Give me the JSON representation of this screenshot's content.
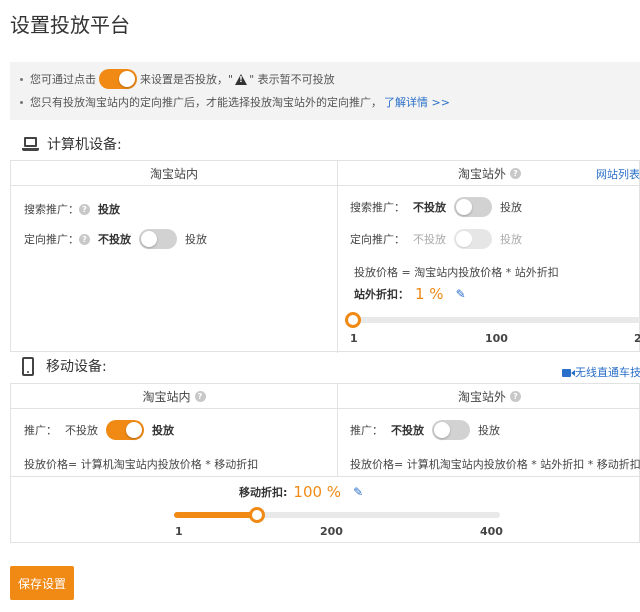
{
  "page": {
    "title": "设置投放平台"
  },
  "notice": {
    "line1_prefix": "您可通过点击",
    "line1_mid": "来设置是否投放，\"",
    "line1_suffix": "\" 表示暂不可投放",
    "line2_text": "您只有投放淘宝站内的定向推广后，才能选择投放淘宝站外的定向推广，",
    "line2_link": "了解详情 >>"
  },
  "pc": {
    "heading": "计算机设备:",
    "col_inside": "淘宝站内",
    "col_outside": "淘宝站外",
    "site_list_link": "网站列表",
    "inside": {
      "search_label": "搜索推广：",
      "search_value": "投放",
      "target_label": "定向推广：",
      "target_off": "不投放",
      "target_on": "投放",
      "target_state": "off"
    },
    "outside": {
      "search_label": "搜索推广：",
      "search_off": "不投放",
      "search_on": "投放",
      "search_state": "off",
      "target_label": "定向推广：",
      "target_off": "不投放",
      "target_on": "投放",
      "target_state": "disabled",
      "price_formula": "投放价格 = 淘宝站内投放价格 * 站外折扣",
      "discount_label": "站外折扣：",
      "discount_value": "1 %",
      "slider": {
        "min_label": "1",
        "mid_label": "100",
        "max_label": "2",
        "value": 1,
        "min": 1,
        "max": 200
      }
    }
  },
  "mobile": {
    "heading": "移动设备:",
    "wireless_link": "无线直通车技",
    "col_inside": "淘宝站内",
    "col_outside": "淘宝站外",
    "inside": {
      "label": "推广：",
      "off": "不投放",
      "on": "投放",
      "state": "on",
      "price_formula": "投放价格= 计算机淘宝站内投放价格 * 移动折扣"
    },
    "outside": {
      "label": "推广：",
      "off": "不投放",
      "on": "投放",
      "state": "off",
      "price_formula": "投放价格= 计算机淘宝站内投放价格 * 站外折扣 * 移动折扣"
    },
    "discount_label": "移动折扣:",
    "discount_value": "100 %",
    "slider": {
      "min_label": "1",
      "mid_label": "200",
      "max_label": "400",
      "value": 100,
      "min": 1,
      "max": 400
    }
  },
  "actions": {
    "save_label": "保存设置"
  },
  "colors": {
    "accent": "#f08a15",
    "link": "#2a6fc9"
  },
  "icons": [
    "warning-icon",
    "laptop-icon",
    "phone-icon",
    "help-icon",
    "pencil-icon",
    "camera-icon"
  ]
}
